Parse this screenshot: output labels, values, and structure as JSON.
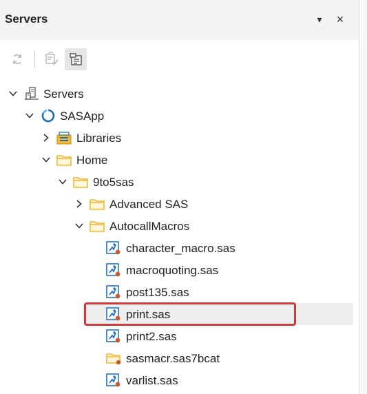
{
  "panel": {
    "title": "Servers",
    "dropdown_glyph": "▾",
    "close_glyph": "×"
  },
  "toolbar": {
    "buttons": [
      {
        "name": "refresh-icon",
        "enabled": false
      },
      {
        "name": "edit-check-icon",
        "enabled": false
      },
      {
        "name": "server-properties-icon",
        "enabled": true,
        "active": true
      }
    ]
  },
  "tree": {
    "rows": [
      {
        "label": "Servers",
        "icon": "servers-icon",
        "expanded": true,
        "depth": 0
      },
      {
        "label": "SASApp",
        "icon": "sasapp-icon",
        "expanded": true,
        "depth": 1
      },
      {
        "label": "Libraries",
        "icon": "libraries-icon",
        "expanded": false,
        "depth": 2
      },
      {
        "label": "Home",
        "icon": "folder-icon",
        "expanded": true,
        "depth": 2
      },
      {
        "label": "9to5sas",
        "icon": "folder-icon",
        "expanded": true,
        "depth": 3
      },
      {
        "label": "Advanced SAS",
        "icon": "folder-icon",
        "expanded": false,
        "depth": 4
      },
      {
        "label": "AutocallMacros",
        "icon": "folder-icon",
        "expanded": true,
        "depth": 4
      },
      {
        "label": "character_macro.sas",
        "icon": "sas-program-icon",
        "depth": 5
      },
      {
        "label": "macroquoting.sas",
        "icon": "sas-program-icon",
        "depth": 5
      },
      {
        "label": "post135.sas",
        "icon": "sas-program-icon",
        "depth": 5
      },
      {
        "label": "print.sas",
        "icon": "sas-program-icon",
        "depth": 5,
        "selected": true
      },
      {
        "label": "print2.sas",
        "icon": "sas-program-icon",
        "depth": 5
      },
      {
        "label": "sasmacr.sas7bcat",
        "icon": "sas-catalog-folder-icon",
        "depth": 5
      },
      {
        "label": "varlist.sas",
        "icon": "sas-program-icon",
        "depth": 5
      }
    ]
  },
  "colors": {
    "folder": "#f5b730",
    "highlight": "#d03a3a",
    "sas_blue": "#1d6fb8",
    "program_dot": "#c85a2a"
  }
}
